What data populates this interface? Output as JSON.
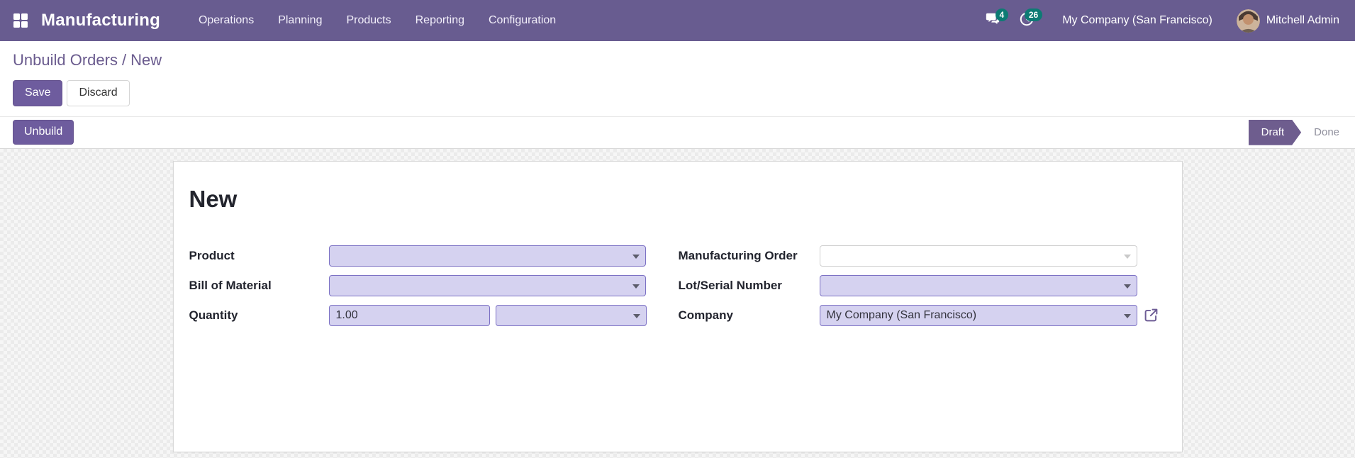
{
  "navbar": {
    "brand": "Manufacturing",
    "menus": [
      "Operations",
      "Planning",
      "Products",
      "Reporting",
      "Configuration"
    ],
    "messages_badge": "4",
    "activities_badge": "26",
    "company_switcher": "My Company (San Francisco)",
    "user_name": "Mitchell Admin"
  },
  "breadcrumb": {
    "parent": "Unbuild Orders",
    "separator": "/",
    "current": "New"
  },
  "actions": {
    "save": "Save",
    "discard": "Discard",
    "unbuild": "Unbuild"
  },
  "statusbar": {
    "active_state": "Draft",
    "inactive_state": "Done"
  },
  "form": {
    "title": "New",
    "fields": {
      "product": {
        "label": "Product",
        "value": ""
      },
      "bill_of_material": {
        "label": "Bill of Material",
        "value": ""
      },
      "quantity": {
        "label": "Quantity",
        "value": "1.00",
        "uom_value": ""
      },
      "manufacturing_order": {
        "label": "Manufacturing Order",
        "value": ""
      },
      "lot_serial_number": {
        "label": "Lot/Serial Number",
        "value": ""
      },
      "company": {
        "label": "Company",
        "value": "My Company (San Francisco)"
      }
    }
  },
  "colors": {
    "navbar_purple": "#685c90",
    "primary_purple": "#6e5c9e",
    "status_arrow_purple": "#6e5d8e",
    "badge_teal": "#0d7b74",
    "field_lavender_bg": "#d5d2f0",
    "field_lavender_border": "#7c71c4",
    "breadcrumb_purple": "#6a5b8e"
  }
}
